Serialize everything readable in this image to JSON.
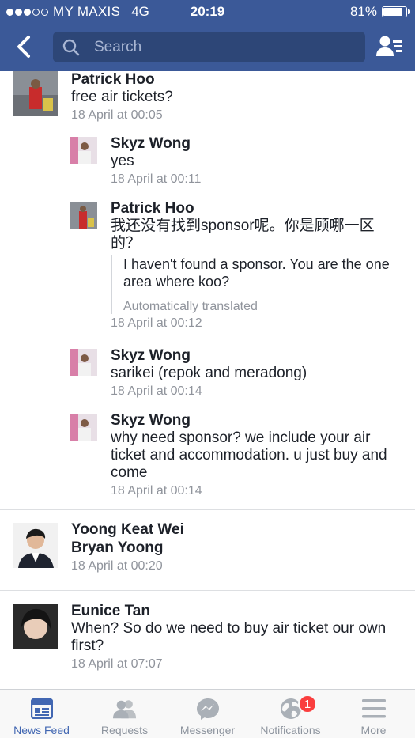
{
  "status_bar": {
    "carrier": "MY MAXIS",
    "network": "4G",
    "time": "20:19",
    "battery": "81%"
  },
  "header": {
    "search_placeholder": "Search"
  },
  "comments": [
    {
      "name": "Patrick Hoo",
      "text": "free air tickets?",
      "time": "18 April at 00:05"
    },
    {
      "name": "Skyz Wong",
      "text": "yes",
      "time": "18 April at 00:11"
    },
    {
      "name": "Patrick Hoo",
      "text": "我还没有找到sponsor呢。你是顾哪一区的？",
      "translation": "I haven't found a sponsor. You are the one area where koo?",
      "translation_note": "Automatically translated",
      "time": "18 April at 00:12"
    },
    {
      "name": "Skyz Wong",
      "text": "sarikei (repok and meradong)",
      "time": "18 April at 00:14"
    },
    {
      "name": "Skyz Wong",
      "text": "why need sponsor? we include your air ticket and accommodation. u just buy and come",
      "time": "18 April at 00:14"
    },
    {
      "name": "Yoong Keat Wei",
      "text": "Bryan Yoong",
      "time": "18 April at 00:20"
    },
    {
      "name": "Eunice Tan",
      "text": "When? So do we need to buy air ticket our own first?",
      "time": "18 April at 07:07"
    }
  ],
  "tabbar": {
    "tabs": [
      {
        "label": "News Feed",
        "icon": "news-feed-icon"
      },
      {
        "label": "Requests",
        "icon": "friend-requests-icon"
      },
      {
        "label": "Messenger",
        "icon": "messenger-icon"
      },
      {
        "label": "Notifications",
        "icon": "globe-icon",
        "badge": "1"
      },
      {
        "label": "More",
        "icon": "menu-icon"
      }
    ]
  },
  "colors": {
    "brand": "#3b5998",
    "active_tab": "#4267b2",
    "badge": "#fa3e3e",
    "meta_text": "#90949c"
  }
}
